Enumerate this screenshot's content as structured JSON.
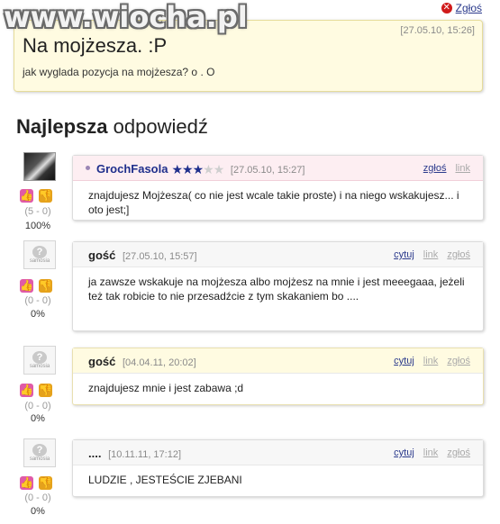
{
  "watermark": "www.wiocha.pl",
  "report_top": "Zgłoś",
  "question": {
    "date": "[27.05.10, 15:26]",
    "title": "Na mojżesza. :P",
    "body": "jak wyglada pozycja na mojżesza? o . O"
  },
  "section": {
    "bold": "Najlepsza",
    "rest": "odpowiedź"
  },
  "answers": [
    {
      "author": "GrochFasola",
      "date": "[27.05.10, 15:27]",
      "rating_stars": 3,
      "links": [
        "zgłoś",
        "link"
      ],
      "text": "znajdujesz Mojżesza( co nie jest wcale takie proste) i na niego wskakujesz... i oto jest;]",
      "votes": "(5 - 0)",
      "percent": "100%"
    },
    {
      "author": "gość",
      "date": "[27.05.10, 15:57]",
      "links": [
        "cytuj",
        "link",
        "zgłoś"
      ],
      "text": "ja zawsze wskakuje na mojżesza albo mojżesz na mnie i jest meeegaaa, jeżeli też tak robicie to nie przesadźcie z tym skakaniem bo ....",
      "votes": "(0 - 0)",
      "percent": "0%"
    },
    {
      "author": "gość",
      "date": "[04.04.11, 20:02]",
      "links": [
        "cytuj",
        "link",
        "zgłoś"
      ],
      "text": "znajdujesz mnie i jest zabawa ;d",
      "votes": "(0 - 0)",
      "percent": "0%"
    },
    {
      "author": "....",
      "date": "[10.11.11, 17:12]",
      "links": [
        "cytuj",
        "link",
        "zgłoś"
      ],
      "text": "LUDZIE , JESTEŚCIE ZJEBANI",
      "votes": "(0 - 0)",
      "percent": "0%"
    }
  ],
  "icons": {
    "avatar_anon_label": "samosia",
    "anon_symbol": "?"
  },
  "colors": {
    "link": "#2b3a8c",
    "question_bg": "#fffbe1",
    "best_head_bg": "#fdeef2",
    "thumb_up": "#e05aa8",
    "thumb_down": "#e5a21c"
  }
}
